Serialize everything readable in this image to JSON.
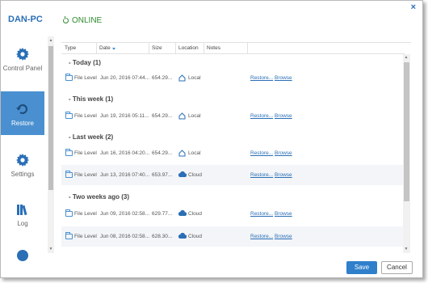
{
  "window": {
    "close_label": "×"
  },
  "header": {
    "pc_name": "DAN-PC",
    "status": "ONLINE",
    "status_color": "#2e8b2e"
  },
  "sidebar": {
    "items": [
      {
        "label": "Control Panel",
        "icon": "gear-icon",
        "active": false
      },
      {
        "label": "Restore",
        "icon": "restore-icon",
        "active": true
      },
      {
        "label": "Settings",
        "icon": "gear-icon",
        "active": false
      },
      {
        "label": "Log",
        "icon": "log-icon",
        "active": false
      },
      {
        "label": "",
        "icon": "info-icon",
        "active": false
      }
    ]
  },
  "table": {
    "columns": [
      "Type",
      "Date",
      "Size",
      "Location",
      "Notes"
    ],
    "sorted_column": "Date",
    "groups": [
      {
        "title": "Today (1)",
        "rows": [
          {
            "type": "File Level",
            "date": "Jun 20, 2016 07:44...",
            "size": "654.29...",
            "location": "Local",
            "location_icon": "home-icon",
            "restore": "Restore...",
            "browse": "Browse"
          }
        ]
      },
      {
        "title": "This week (1)",
        "rows": [
          {
            "type": "File Level",
            "date": "Jun 19, 2016 05:11...",
            "size": "654.29...",
            "location": "Local",
            "location_icon": "home-icon",
            "restore": "Restore...",
            "browse": "Browse"
          }
        ]
      },
      {
        "title": "Last week (2)",
        "rows": [
          {
            "type": "File Level",
            "date": "Jun 16, 2016 04:20...",
            "size": "654.29...",
            "location": "Local",
            "location_icon": "home-icon",
            "restore": "Restore...",
            "browse": "Browse"
          },
          {
            "type": "File Level",
            "date": "Jun 13, 2016 07:40...",
            "size": "653.97...",
            "location": "Cloud",
            "location_icon": "cloud-icon",
            "restore": "Restore...",
            "browse": "Browse"
          }
        ]
      },
      {
        "title": "Two weeks ago (3)",
        "rows": [
          {
            "type": "File Level",
            "date": "Jun 09, 2016 02:58...",
            "size": "629.77...",
            "location": "Cloud",
            "location_icon": "cloud-icon",
            "restore": "Restore...",
            "browse": "Browse"
          },
          {
            "type": "File Level",
            "date": "Jun 08, 2016 02:58...",
            "size": "628.30...",
            "location": "Cloud",
            "location_icon": "cloud-icon",
            "restore": "Restore...",
            "browse": "Browse"
          }
        ]
      }
    ]
  },
  "footer": {
    "save_label": "Save",
    "cancel_label": "Cancel"
  },
  "colors": {
    "accent": "#2f7fcb",
    "active_nav": "#4a90d0"
  }
}
